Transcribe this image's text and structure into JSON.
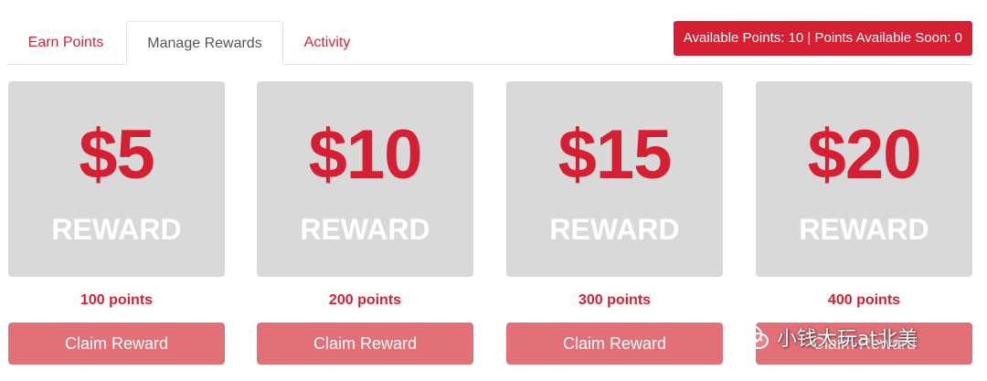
{
  "tabs": [
    {
      "label": "Earn Points"
    },
    {
      "label": "Manage Rewards",
      "active": true
    },
    {
      "label": "Activity"
    }
  ],
  "points_badge": "Available Points: 10 | Points Available Soon: 0",
  "rewards": [
    {
      "amount": "$5",
      "word": "REWARD",
      "points": "100 points",
      "button": "Claim Reward"
    },
    {
      "amount": "$10",
      "word": "REWARD",
      "points": "200 points",
      "button": "Claim Reward"
    },
    {
      "amount": "$15",
      "word": "REWARD",
      "points": "300 points",
      "button": "Claim Reward"
    },
    {
      "amount": "$20",
      "word": "REWARD",
      "points": "400 points",
      "button": "Claim Reward"
    }
  ],
  "watermark": {
    "text": "小钱大玩at北美",
    "icon": "wechat-icon"
  },
  "colors": {
    "brand_red": "#d71f33",
    "card_gray": "#d9d9d9",
    "button_pink": "#e36f77"
  }
}
